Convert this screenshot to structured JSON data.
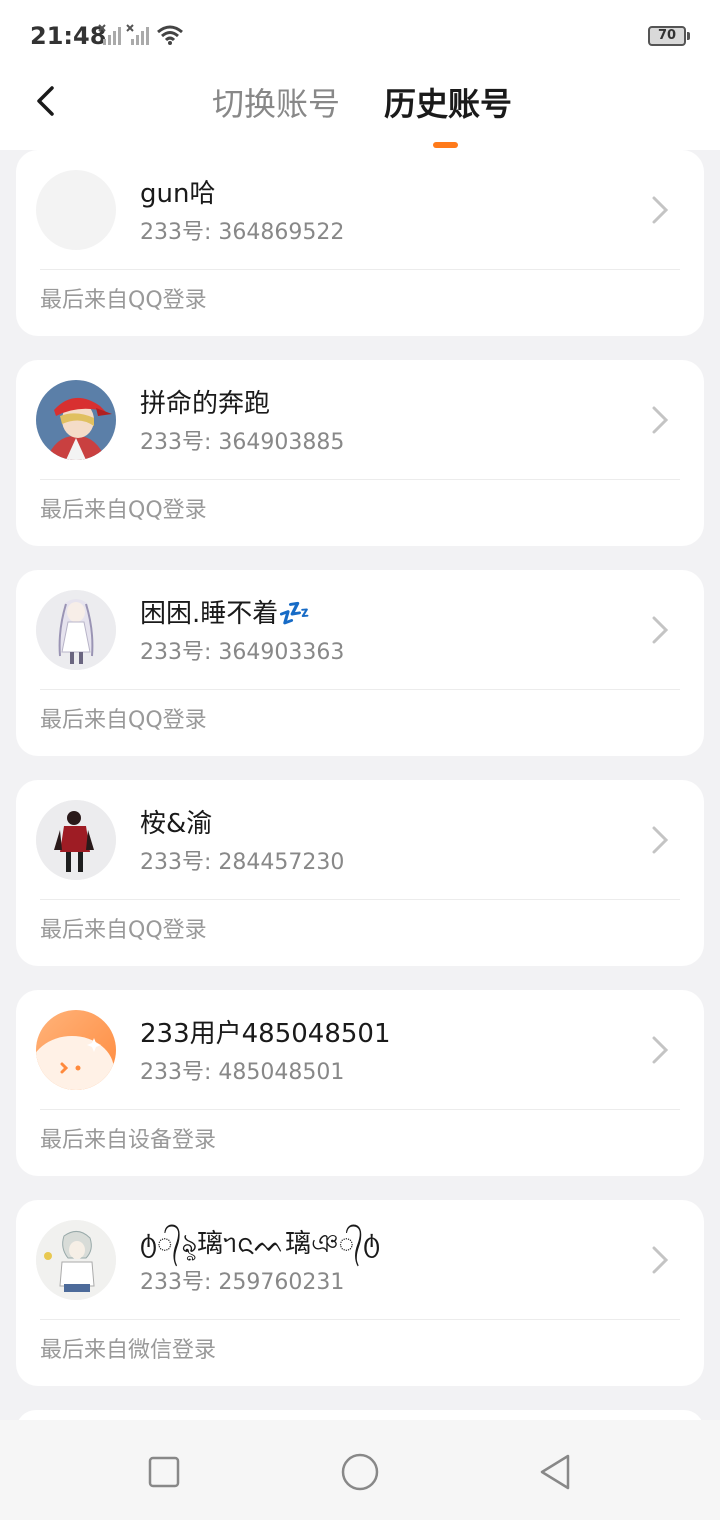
{
  "status_bar": {
    "time": "21:48",
    "battery": "70",
    "icons": [
      "signal-no-sim-icon",
      "signal-no-sim-icon",
      "wifi-icon"
    ]
  },
  "header": {
    "back_icon": "chevron-left-icon",
    "tabs": [
      {
        "label": "切换账号",
        "active": false
      },
      {
        "label": "历史账号",
        "active": true
      }
    ],
    "accent_color": "#ff7a1a"
  },
  "accounts": [
    {
      "nickname": "gun哈",
      "id_prefix": "233号: ",
      "id": "364869522",
      "login_source": "最后来自QQ登录",
      "avatar": "blank-avatar"
    },
    {
      "nickname": "拼命的奔跑",
      "id_prefix": "233号: ",
      "id": "364903885",
      "login_source": "最后来自QQ登录",
      "avatar": "anime-boy-red-cap-avatar"
    },
    {
      "nickname": "困困.睡不着💤",
      "id_prefix": "233号: ",
      "id": "364903363",
      "login_source": "最后来自QQ登录",
      "avatar": "anime-girl-white-hair-avatar"
    },
    {
      "nickname": "桉&渝",
      "id_prefix": "233号: ",
      "id": "284457230",
      "login_source": "最后来自QQ登录",
      "avatar": "chibi-dark-figure-avatar"
    },
    {
      "nickname": "233用户485048501",
      "id_prefix": "233号: ",
      "id": "485048501",
      "login_source": "最后来自设备登录",
      "avatar": "orange-blob-default-avatar"
    },
    {
      "nickname": "ტ᭄ৡ璃ᥐᨶᨓ璃ঞ᭄ტ",
      "id_prefix": "233号: ",
      "id": "259760231",
      "login_source": "最后来自微信登录",
      "avatar": "sketch-character-avatar"
    }
  ],
  "nav_bar": {
    "icons": [
      "recent-apps-icon",
      "home-icon",
      "back-triangle-icon"
    ]
  }
}
